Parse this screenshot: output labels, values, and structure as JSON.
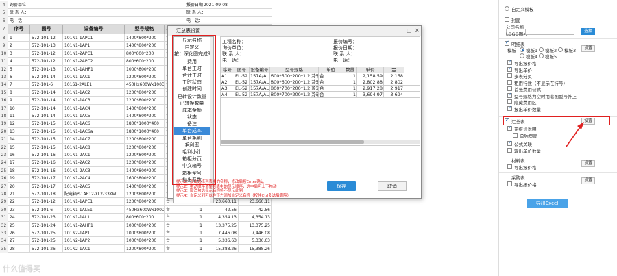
{
  "sheet": {
    "info_rows": [
      {
        "rn": "4",
        "left": "询价单位：",
        "right": "报价日期：",
        "right_value": "2021-09-08"
      },
      {
        "rn": "5",
        "left": "联 系 人：",
        "right": "联 系 人："
      },
      {
        "rn": "6",
        "left": "电　话：",
        "right": "电　话："
      }
    ],
    "header": {
      "rn": "7",
      "cols": [
        "序号",
        "图号",
        "设备编号",
        "型号规格",
        "单"
      ]
    },
    "rows": [
      {
        "rn": "8",
        "c": [
          "1",
          "572-101-12",
          "101N1-1APC1",
          "1400*800*200",
          "台"
        ]
      },
      {
        "rn": "9",
        "c": [
          "2",
          "572-101-13",
          "101N1-1AP1",
          "1400*800*200",
          "台"
        ]
      },
      {
        "rn": "10",
        "c": [
          "3",
          "572-101-12",
          "101N1-2APC1",
          "800*600*200",
          "台"
        ]
      },
      {
        "rn": "11",
        "c": [
          "4",
          "572-101-12",
          "101N1-2APC2",
          "800*600*200",
          "台"
        ]
      },
      {
        "rn": "12",
        "c": [
          "5",
          "572-101-13",
          "101N1-1AHP1",
          "1000*800*200",
          "台"
        ]
      },
      {
        "rn": "13",
        "c": [
          "6",
          "572-101-14",
          "101N1-1AC1",
          "1200*800*200",
          "台"
        ]
      },
      {
        "rn": "14",
        "c": [
          "7",
          "572-101-6",
          "101S1-2ALE1",
          "450Hx600Wx100D",
          "台"
        ]
      },
      {
        "rn": "15",
        "c": [
          "8",
          "572-101-14",
          "101N1-1AC2",
          "1200*800*200",
          "台"
        ]
      },
      {
        "rn": "16",
        "c": [
          "9",
          "572-101-14",
          "101N1-1AC3",
          "1200*800*200",
          "台"
        ]
      },
      {
        "rn": "17",
        "c": [
          "10",
          "572-101-14",
          "101N1-1AC4",
          "1400*800*200",
          "台"
        ]
      },
      {
        "rn": "18",
        "c": [
          "11",
          "572-101-14",
          "101N1-1AC5",
          "1400*800*200",
          "台"
        ]
      },
      {
        "rn": "19",
        "c": [
          "12",
          "572-101-15",
          "101N1-1AC6",
          "1800*1000*400",
          "台"
        ]
      },
      {
        "rn": "20",
        "c": [
          "13",
          "572-101-15",
          "101N1-1AC6a",
          "1800*1000*400",
          "台"
        ]
      },
      {
        "rn": "21",
        "c": [
          "14",
          "572-101-15",
          "101N1-1AC7",
          "1200*800*200",
          "台"
        ]
      },
      {
        "rn": "22",
        "c": [
          "15",
          "572-101-15",
          "101N1-1AC8",
          "1200*800*200",
          "台"
        ]
      },
      {
        "rn": "23",
        "c": [
          "16",
          "572-101-16",
          "101N1-2AC1",
          "1200*800*200",
          "台"
        ]
      },
      {
        "rn": "24",
        "c": [
          "17",
          "572-101-16",
          "101N1-2AC2",
          "1200*800*200",
          "台"
        ]
      },
      {
        "rn": "25",
        "c": [
          "18",
          "572-101-16",
          "101N1-2AC3",
          "1400*800*200",
          "台"
        ]
      },
      {
        "rn": "26",
        "c": [
          "19",
          "572-101-17",
          "101N1-2AC4",
          "1600*800*200",
          "台"
        ]
      },
      {
        "rn": "27",
        "c": [
          "20",
          "572-101-17",
          "101N1-2AC5",
          "1400*800*200",
          "台",
          "1",
          "67,276.78",
          "67,276.78"
        ]
      },
      {
        "rn": "28",
        "c": [
          "21",
          "572-101-18",
          "配电箱P-1AP12-XL2-33KW",
          "1200*800*200",
          "台",
          "1",
          "13,994.88",
          "13,994.88"
        ]
      },
      {
        "rn": "29",
        "c": [
          "22",
          "572-101-12",
          "101N1-1APE1",
          "1200*800*200",
          "台",
          "1",
          "23,660.11",
          "23,660.11"
        ]
      },
      {
        "rn": "30",
        "c": [
          "23",
          "572-101-6",
          "101N1-1ALE1",
          "450Hx600Wx100D",
          "台",
          "1",
          "42.56",
          "42.56"
        ]
      },
      {
        "rn": "31",
        "c": [
          "24",
          "572-101-23",
          "101N1-1AL1",
          "800*600*200",
          "台",
          "1",
          "4,354.13",
          "4,354.13"
        ]
      },
      {
        "rn": "32",
        "c": [
          "25",
          "572-101-24",
          "101N1-2AHP1",
          "1000*800*200",
          "台",
          "1",
          "13,375.25",
          "13,375.25"
        ]
      },
      {
        "rn": "33",
        "c": [
          "26",
          "572-101-25",
          "101N2-1AP1",
          "1000*800*200",
          "台",
          "1",
          "7,446.08",
          "7,446.08"
        ]
      },
      {
        "rn": "34",
        "c": [
          "27",
          "572-101-25",
          "101N2-1AP2",
          "1000*800*200",
          "台",
          "1",
          "5,336.63",
          "5,336.63"
        ]
      },
      {
        "rn": "35",
        "c": [
          "28",
          "572-101-26",
          "101N2-1AC1",
          "1200*800*200",
          "台",
          "1",
          "15,388.26",
          "15,388.26"
        ]
      }
    ]
  },
  "dialog": {
    "title": "汇总表设置",
    "columns": [
      "显示名称",
      "自定义",
      "按计深化图完成时",
      "费用",
      "单台工时",
      "合计工时",
      "工时状态",
      "创建时间",
      "已转设计数量",
      "已转换数量",
      "成本金额",
      "状态",
      "备注",
      "单台成本",
      "单台毛利",
      "毛利率",
      "毛利小计",
      "箱柜分页",
      "中文箱号",
      "箱柜型号",
      "抛出系数"
    ],
    "selected_index": 13,
    "preview": {
      "info_left": [
        "工程名称：",
        "询价单位：",
        "联 系 人：",
        "电　话："
      ],
      "info_right": [
        "报价编号：",
        "报价日期：",
        "联 系 人：",
        "电　话："
      ],
      "headers": [
        "序号",
        "图号",
        "设备编号",
        "型号规格",
        "单位",
        "数量",
        "单价",
        "金"
      ],
      "rows": [
        [
          "A1",
          "EL-52",
          "157A/AL1",
          "600*500*200*1.2 冷轧钢板",
          "台",
          "1",
          "2,158.59",
          "2,158"
        ],
        [
          "A2",
          "EL-52",
          "157A/AL2",
          "800*600*200*1.2 冷轧钢板",
          "台",
          "1",
          "2,802.88",
          "2,802"
        ],
        [
          "A3",
          "EL-52",
          "157A/AL3",
          "800*700*200*1.2 冷轧钢板",
          "台",
          "1",
          "2,917.28",
          "2,917"
        ],
        [
          "A4",
          "EL-52",
          "157A/AL4",
          "800*700*200*1.2 冷轧钢板",
          "台",
          "1",
          "3,694.97",
          "3,694"
        ]
      ]
    },
    "hint": [
      "提示1：双击选择列表中的名称，修改后按Enter确认",
      "提示2：拖动顺序调整列表中的显示顺序，选中后可上下拖动",
      "提示3：取消勾选显示名称将不显示此列",
      "提示4：自定义列可以在下方添加自定义名称（按住Ctrl多选后删除）"
    ],
    "save_label": "保存",
    "cancel_label": "取消"
  },
  "panel": {
    "top_radio": "自定义模板",
    "cover": "封面",
    "company_name_label": "公司名称",
    "logo_label": "LOGO图片",
    "logo_btn": "选择",
    "detail": "明细表",
    "template_label": "模板",
    "tpl": [
      "模板1",
      "模板2",
      "模板3",
      "模板4",
      "模板5"
    ],
    "setup": "设置",
    "detail_opts": [
      "导出报价格",
      "导出单价",
      "多表分页",
      "租用行数（不显示在行号）",
      "首张费用公式",
      "型号规格为空时用套图型号补上",
      "隐藏费用区",
      "报出单价数量"
    ],
    "summary": "汇总表",
    "summary_opts": [
      "带报价说明",
      "单独页面",
      "公式关联",
      "输出单价数量"
    ],
    "material": "材料表",
    "material_opt": "导出报价格",
    "purchase": "采购表",
    "purchase_opt": "导出报价格",
    "export": "导出Excel"
  },
  "watermark": "什么值得买"
}
